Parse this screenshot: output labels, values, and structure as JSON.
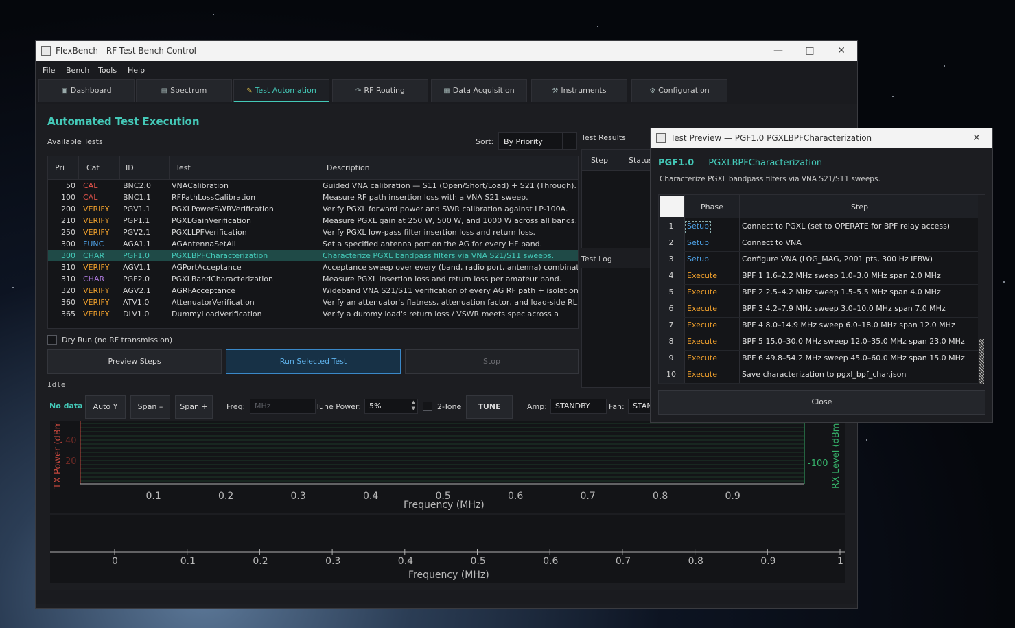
{
  "window": {
    "title": "FlexBench - RF Test Bench Control",
    "menu": [
      "File",
      "Bench",
      "Tools",
      "Help"
    ],
    "tabs": [
      {
        "label": "Dashboard",
        "icon": "dashboard-icon"
      },
      {
        "label": "Spectrum",
        "icon": "spectrum-icon"
      },
      {
        "label": "Test Automation",
        "icon": "pencil-icon"
      },
      {
        "label": "RF Routing",
        "icon": "routing-icon"
      },
      {
        "label": "Data Acquisition",
        "icon": "data-icon"
      },
      {
        "label": "Instruments",
        "icon": "wrench-icon"
      },
      {
        "label": "Configuration",
        "icon": "gear-icon"
      }
    ]
  },
  "automation": {
    "heading": "Automated Test Execution",
    "available_label": "Available Tests",
    "sort_label": "Sort:",
    "sort_value": "By Priority",
    "columns": [
      "Pri",
      "Cat",
      "ID",
      "Test",
      "Description"
    ],
    "tests": [
      {
        "pri": "50",
        "cat": "CAL",
        "id": "BNC2.0",
        "test": "VNACalibration",
        "desc": "Guided VNA calibration — S11 (Open/Short/Load) + S21 (Through)."
      },
      {
        "pri": "100",
        "cat": "CAL",
        "id": "BNC1.1",
        "test": "RFPathLossCalibration",
        "desc": "Measure RF path insertion loss with a VNA S21 sweep."
      },
      {
        "pri": "200",
        "cat": "VERIFY",
        "id": "PGV1.1",
        "test": "PGXLPowerSWRVerification",
        "desc": "Verify PGXL forward power and SWR calibration against LP-100A."
      },
      {
        "pri": "210",
        "cat": "VERIFY",
        "id": "PGP1.1",
        "test": "PGXLGainVerification",
        "desc": "Measure PGXL gain at 250 W, 500 W, and 1000 W across all bands."
      },
      {
        "pri": "250",
        "cat": "VERIFY",
        "id": "PGV2.1",
        "test": "PGXLLPFVerification",
        "desc": "Verify PGXL low-pass filter insertion loss and return loss."
      },
      {
        "pri": "300",
        "cat": "FUNC",
        "id": "AGA1.1",
        "test": "AGAntennaSetAll",
        "desc": "Set a specified antenna port on the AG for every HF band."
      },
      {
        "pri": "300",
        "cat": "CHAR",
        "id": "PGF1.0",
        "test": "PGXLBPFCharacterization",
        "desc": "Characterize PGXL bandpass filters via VNA S21/S11 sweeps."
      },
      {
        "pri": "310",
        "cat": "VERIFY",
        "id": "AGV1.1",
        "test": "AGPortAcceptance",
        "desc": "Acceptance sweep over every (band, radio port, antenna) combination."
      },
      {
        "pri": "310",
        "cat": "CHAR",
        "id": "PGF2.0",
        "test": "PGXLBandCharacterization",
        "desc": "Measure PGXL insertion loss and return loss per amateur band."
      },
      {
        "pri": "320",
        "cat": "VERIFY",
        "id": "AGV2.1",
        "test": "AGRFAcceptance",
        "desc": "Wideband VNA S21/S11 verification of every AG RF path + isolation."
      },
      {
        "pri": "360",
        "cat": "VERIFY",
        "id": "ATV1.0",
        "test": "AttenuatorVerification",
        "desc": "Verify an attenuator's flatness, attenuation factor, and load-side RL."
      },
      {
        "pri": "365",
        "cat": "VERIFY",
        "id": "DLV1.0",
        "test": "DummyLoadVerification",
        "desc": "Verify a dummy load's return loss / VSWR meets spec across a"
      }
    ],
    "selected_index": 6,
    "cat_colors": {
      "CAL": "#e4534b",
      "VERIFY": "#f0a02c",
      "FUNC": "#4ea3e8",
      "CHAR": "#b07be0"
    },
    "dry_run_label": "Dry Run (no RF transmission)",
    "preview_button": "Preview Steps",
    "run_button": "Run Selected Test",
    "stop_button": "Stop",
    "status": "Idle",
    "results_label": "Test Results",
    "results_columns": [
      "Step",
      "Status"
    ],
    "log_label": "Test Log"
  },
  "controls": {
    "no_data": "No data",
    "auto_y": "Auto Y",
    "span_minus": "Span –",
    "span_plus": "Span +",
    "freq_label": "Freq:",
    "freq_placeholder": "MHz",
    "tune_power_label": "Tune Power:",
    "tune_power_value": "5%",
    "two_tone_label": "2-Tone",
    "tune_button": "TUNE",
    "amp_label": "Amp:",
    "amp_value": "STANDBY",
    "fan_label": "Fan:",
    "fan_value": "STAN"
  },
  "plot_top": {
    "ylabel_left": "TX Power (dBm)",
    "ylabel_right": "RX Level (dBm)",
    "left_ticks": [
      "40",
      "20"
    ],
    "right_ticks": [
      "-100"
    ],
    "x_ticks": [
      "0.1",
      "0.2",
      "0.3",
      "0.4",
      "0.5",
      "0.6",
      "0.7",
      "0.8",
      "0.9"
    ],
    "xlabel": "Frequency (MHz)"
  },
  "plot_bottom": {
    "x_ticks": [
      "0",
      "0.1",
      "0.2",
      "0.3",
      "0.4",
      "0.5",
      "0.6",
      "0.7",
      "0.8",
      "0.9",
      "1"
    ],
    "xlabel": "Frequency (MHz)"
  },
  "dialog": {
    "title": "Test Preview — PGF1.0 PGXLBPFCharacterization",
    "head_id": "PGF1.0",
    "head_dash": "—",
    "head_name": "PGXLBPFCharacterization",
    "subtitle": "Characterize PGXL bandpass filters via VNA S21/S11 sweeps.",
    "columns": [
      "Phase",
      "Step"
    ],
    "steps": [
      {
        "n": "1",
        "phase": "Setup",
        "step": "Connect to PGXL (set to OPERATE for BPF relay access)"
      },
      {
        "n": "2",
        "phase": "Setup",
        "step": "Connect to VNA"
      },
      {
        "n": "3",
        "phase": "Setup",
        "step": "Configure VNA (LOG_MAG, 2001 pts, 300 Hz IFBW)"
      },
      {
        "n": "4",
        "phase": "Execute",
        "step": "BPF 1  1.6–2.2 MHz  sweep 1.0–3.0 MHz  span 2.0 MHz"
      },
      {
        "n": "5",
        "phase": "Execute",
        "step": "BPF 2  2.5–4.2 MHz  sweep 1.5–5.5 MHz  span 4.0 MHz"
      },
      {
        "n": "6",
        "phase": "Execute",
        "step": "BPF 3  4.2–7.9 MHz  sweep 3.0–10.0 MHz  span 7.0 MHz"
      },
      {
        "n": "7",
        "phase": "Execute",
        "step": "BPF 4  8.0–14.9 MHz  sweep 6.0–18.0 MHz  span 12.0 MHz"
      },
      {
        "n": "8",
        "phase": "Execute",
        "step": "BPF 5  15.0–30.0 MHz  sweep 12.0–35.0 MHz  span 23.0 MHz"
      },
      {
        "n": "9",
        "phase": "Execute",
        "step": "BPF 6  49.8–54.2 MHz  sweep 45.0–60.0 MHz  span 15.0 MHz"
      },
      {
        "n": "10",
        "phase": "Execute",
        "step": "Save characterization to pgxl_bpf_char.json"
      }
    ],
    "close_button": "Close"
  }
}
